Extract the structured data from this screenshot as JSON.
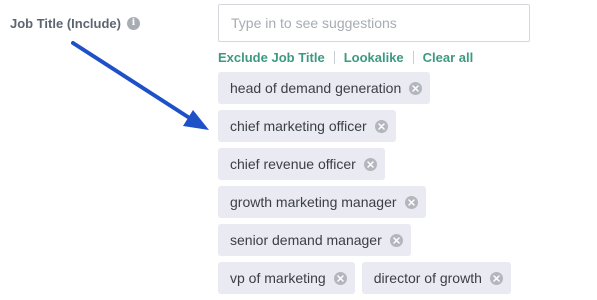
{
  "filter": {
    "label": "Job Title (Include)",
    "info_icon": "info-icon",
    "search_placeholder": "Type in to see suggestions",
    "search_value": ""
  },
  "actions": {
    "exclude_label": "Exclude Job Title",
    "lookalike_label": "Lookalike",
    "clear_label": "Clear all"
  },
  "tags": [
    "head of demand generation",
    "chief marketing officer",
    "chief revenue officer",
    "growth marketing manager",
    "senior demand manager",
    "vp of marketing",
    "director of growth"
  ],
  "colors": {
    "action_link": "#3d9a82",
    "tag_background": "#e9eaf2",
    "annotation_arrow": "#1e50c8"
  }
}
